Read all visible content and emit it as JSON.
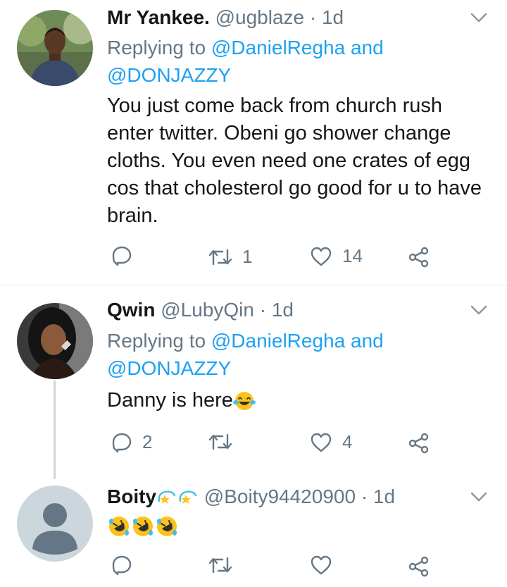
{
  "tweets": [
    {
      "name": "Mr Yankee.",
      "handle": "@ugblaze",
      "sep": "·",
      "time": "1d",
      "replying_prefix": "Replying to ",
      "mention1": "@DanielRegha",
      "and": " and",
      "mention2": "@DONJAZZY",
      "text": "You just come back from church rush enter twitter. Obeni go shower change cloths. You even need one crates of egg cos that cholesterol go good for u to have brain.",
      "reply_count": "",
      "retweet_count": "1",
      "like_count": "14"
    },
    {
      "name": "Qwin",
      "handle": "@LubyQin",
      "sep": "·",
      "time": "1d",
      "replying_prefix": "Replying to ",
      "mention1": "@DanielRegha",
      "and": " and",
      "mention2": "@DONJAZZY",
      "text": "Danny is here",
      "reply_count": "2",
      "retweet_count": "",
      "like_count": "4"
    },
    {
      "name": "Boity",
      "handle": "@Boity94420900",
      "sep": "·",
      "time": "1d",
      "reply_count": "",
      "retweet_count": "",
      "like_count": ""
    }
  ],
  "colors": {
    "accent": "#1da1f2",
    "secondary": "#657786",
    "divider": "#e1e8ed"
  },
  "icons": [
    "reply-icon",
    "retweet-icon",
    "like-icon",
    "share-icon",
    "chevron-down-icon",
    "laughing-emoji",
    "rolling-laughing-emoji",
    "dizzy-emoji"
  ]
}
